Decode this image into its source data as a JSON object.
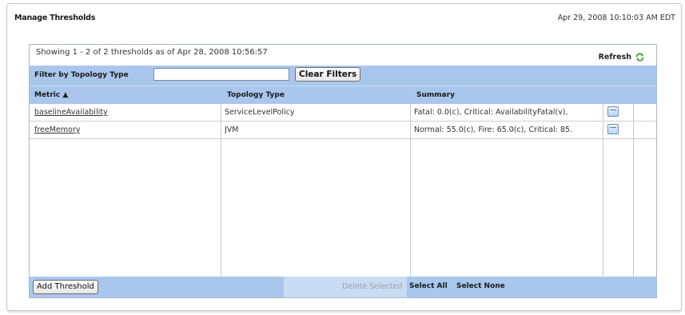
{
  "header": {
    "title": "Manage Thresholds",
    "timestamp": "Apr 29, 2008 10:10:03 AM EDT"
  },
  "panel": {
    "showing_text": "Showing 1 - 2  of 2 thresholds as of Apr 28, 2008 10:56:57",
    "refresh_label": "Refresh"
  },
  "filter": {
    "label": "Filter by Topology Type",
    "value": "",
    "clear_label": "Clear Filters"
  },
  "table": {
    "columns": [
      "Metric ▲",
      "Topology Type",
      "Summary"
    ],
    "rows": [
      {
        "metric": "baselineAvailability",
        "topology": "ServiceLevelPolicy",
        "summary": "Fatal: 0.0(c), Critical: AvailabilityFatal(v),"
      },
      {
        "metric": "freeMemory",
        "topology": "JVM",
        "summary": "Normal: 55.0(c), Fire: 65.0(c), Critical: 85."
      }
    ]
  },
  "footer": {
    "add_label": "Add Threshold",
    "delete_label": "Delete Selected",
    "select_all_label": "Select All",
    "select_none_label": "Select None"
  },
  "colors": {
    "header_blue": "#a9c7ec",
    "refresh_green": "#3aa33a"
  },
  "icons": {
    "refresh": "refresh-icon",
    "row_action": "edit-icon",
    "sort": "sort-ascending-icon"
  }
}
